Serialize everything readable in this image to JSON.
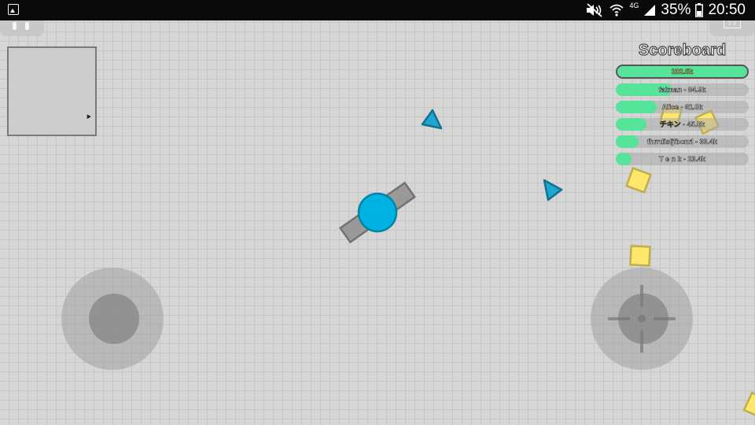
{
  "status_bar": {
    "network": "4G",
    "battery": "35%",
    "time": "20:50"
  },
  "leaderboard_icon_text": "2 3",
  "scoreboard": {
    "title": "Scoreboard",
    "entries": [
      {
        "label": "202.5k",
        "fill": 1.0
      },
      {
        "label": "fatman - 84.9k",
        "fill": 0.42
      },
      {
        "label": "Alice - 61.0k",
        "fill": 0.31
      },
      {
        "label": "チキン - 45.0k",
        "fill": 0.23
      },
      {
        "label": "fhrrdisljfbcnrl - 33.4k",
        "fill": 0.17
      },
      {
        "label": "T e n k - 23.4k",
        "fill": 0.12
      }
    ]
  },
  "colors": {
    "player_body": "#00b2e1",
    "player_barrel": "#999999",
    "triangle": "#1ca6d2",
    "square": "#ffe76c",
    "scoreboard_fill": "#56e39a",
    "background": "#d6d6d6"
  },
  "icons": {
    "gallery": "gallery-icon",
    "mute": "mute-icon",
    "wifi": "wifi-icon",
    "signal": "signal-icon",
    "battery": "battery-icon",
    "pause": "pause-icon",
    "leaderboard": "leaderboard-icon"
  }
}
